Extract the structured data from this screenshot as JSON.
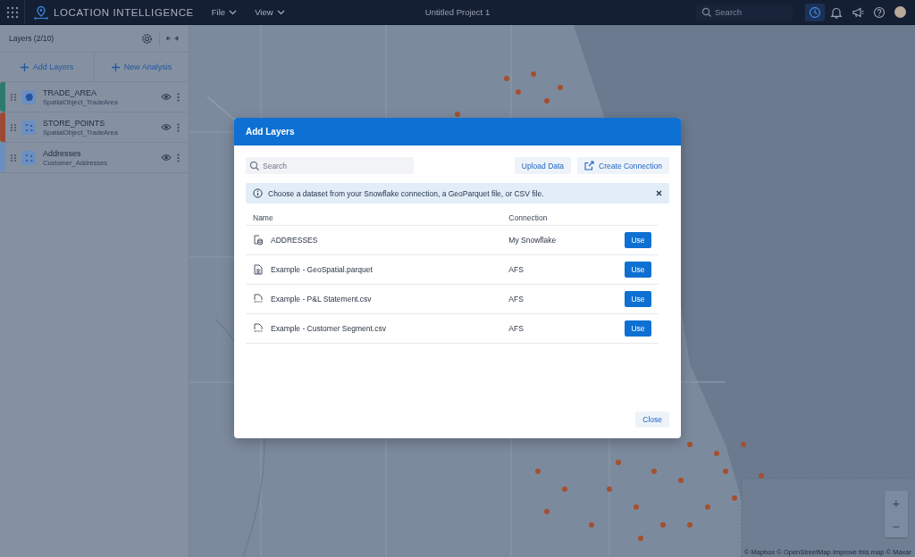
{
  "top_bar": {
    "app_name": "LOCATION INTELLIGENCE",
    "menus": [
      "File",
      "View"
    ],
    "project_title": "Untitled Project 1",
    "search": {
      "placeholder": "Search"
    },
    "tools": [
      {
        "kind": "history",
        "selected": true
      },
      {
        "kind": "bell",
        "selected": false
      },
      {
        "kind": "megaphone",
        "selected": false
      },
      {
        "kind": "help",
        "selected": false
      }
    ]
  },
  "sidebar": {
    "title": "Layers (2/10)",
    "actions": [
      "Add Layers",
      "New Analysis"
    ],
    "layers": [
      {
        "name": "TRADE_AREA",
        "source": "SpatialObject_TradeArea",
        "kind": "polygon",
        "color": "#2e7a6c",
        "visible": true
      },
      {
        "name": "STORE_POINTS",
        "source": "SpatialObject_TradeArea",
        "kind": "points",
        "color": "#9c4a35",
        "visible": true
      },
      {
        "name": "Addresses",
        "source": "Customer_Addresses",
        "kind": "points",
        "color": "#6c8fbe",
        "visible": true
      }
    ]
  },
  "map": {
    "zoom_in": "+",
    "zoom_out": "−",
    "attribution": "© Mapbox © OpenStreetMap Improve this map © Maxar"
  },
  "dialog": {
    "title": "Add Layers",
    "search": {
      "placeholder": "Search"
    },
    "buttons": [
      {
        "label": "Upload Data",
        "kind": "plain"
      },
      {
        "label": "Create Connection",
        "kind": "external"
      }
    ],
    "notice": "Choose a dataset from your Snowflake connection, a GeoParquet file, or CSV file.",
    "columns": [
      "Name",
      "Connection"
    ],
    "rows": [
      {
        "name": "ADDRESSES",
        "connection": "My Snowflake",
        "kind": "table",
        "action": "Use"
      },
      {
        "name": "Example - GeoSpatial.parquet",
        "connection": "AFS",
        "kind": "parquet",
        "action": "Use"
      },
      {
        "name": "Example - P&L Statement.csv",
        "connection": "AFS",
        "kind": "csv",
        "action": "Use"
      },
      {
        "name": "Example - Customer Segment.csv",
        "connection": "AFS",
        "kind": "csv",
        "action": "Use"
      }
    ],
    "close": "Close"
  }
}
